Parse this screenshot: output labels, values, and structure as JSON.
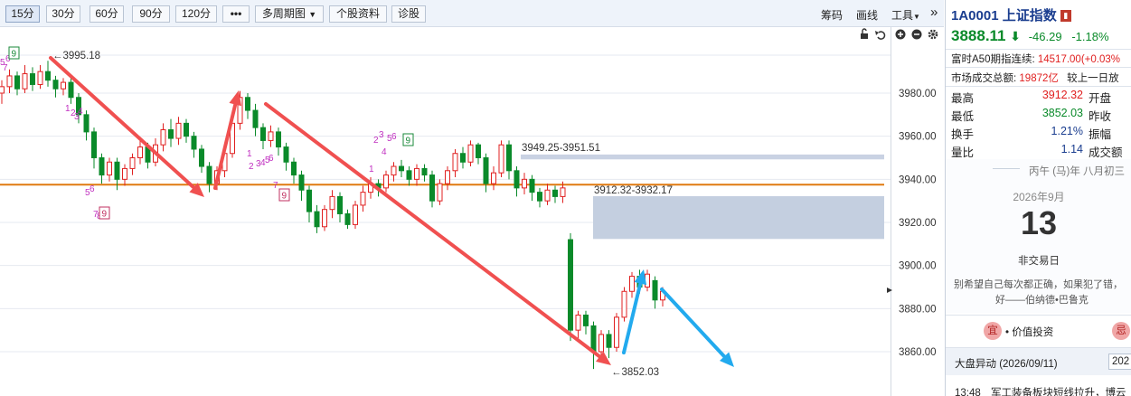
{
  "toolbar": {
    "periods": [
      "15分",
      "30分",
      "60分",
      "90分",
      "120分"
    ],
    "active_period": "15分",
    "more": "•••",
    "multi_period": "多周期图",
    "stock_info": "个股资料",
    "diagnose": "诊股",
    "chips": "筹码",
    "draw": "画线",
    "tools": "工具",
    "expand": "»"
  },
  "stock": {
    "code": "1A0001",
    "name": "上证指数",
    "badge": "■",
    "price": "3888.11",
    "change": "-46.29",
    "change_pct": "-1.18%",
    "a50_label": "富时A50期指连续:",
    "a50_value": "14517.00(+0.03%",
    "turnover_label": "市场成交总额:",
    "turnover_value": "19872亿",
    "turnover_compare": "较上一日放",
    "quote": [
      {
        "label": "最高",
        "value": "3912.32",
        "label2": "开盘",
        "value2": ""
      },
      {
        "label": "最低",
        "value": "3852.03",
        "label2": "昨收",
        "value2": ""
      },
      {
        "label": "换手",
        "value": "1.21%",
        "label2": "振幅",
        "value2": ""
      },
      {
        "label": "量比",
        "value": "1.14",
        "label2": "成交额",
        "value2": ""
      }
    ]
  },
  "calendar": {
    "lunar": "丙午 (马)年 八月初三",
    "month": "2026年9月",
    "day": "13",
    "status": "非交易日",
    "quote_line1": "别希望自己每次都正确，如果犯了错，",
    "quote_line2": "好——伯纳德•巴鲁克",
    "good_badge": "宜",
    "good_text": "• 价值投资",
    "bad_badge": "忌"
  },
  "news": {
    "title": "大盘异动 (2026/09/11)",
    "date_button": "202",
    "time": "13:48",
    "text": "军工装备板块短线拉升，博云"
  },
  "chart_data": {
    "type": "candlestick",
    "ylim": [
      3848,
      4002
    ],
    "yticks": [
      "3860.00",
      "3880.00",
      "3900.00",
      "3920.00",
      "3940.00",
      "3960.00",
      "3980.00"
    ],
    "ytick_values": [
      3860,
      3880,
      3900,
      3920,
      3940,
      3960,
      3980
    ],
    "annotations": {
      "high_label": "←3995.18",
      "low_label": "←3852.03",
      "zone1_label": "3949.25-3951.51",
      "zone2_label": "3912.32-3932.17"
    },
    "horizontal_line": 3937.5,
    "gap_zone1": [
      3949.25,
      3951.51
    ],
    "gap_zone2": [
      3912.32,
      3932.17
    ],
    "td_labels": [
      "9",
      "7",
      "9",
      "9"
    ],
    "candles": [
      [
        3980,
        3983,
        3975,
        3986
      ],
      [
        3983,
        3988,
        3980,
        3991
      ],
      [
        3988,
        3982,
        3979,
        3990
      ],
      [
        3982,
        3989,
        3980,
        3993
      ],
      [
        3989,
        3984,
        3981,
        3992
      ],
      [
        3984,
        3990,
        3982,
        3993
      ],
      [
        3990,
        3986,
        3983,
        3995
      ],
      [
        3986,
        3982,
        3978,
        3988
      ],
      [
        3982,
        3985,
        3979,
        3987
      ],
      [
        3985,
        3978,
        3975,
        3987
      ],
      [
        3978,
        3970,
        3966,
        3980
      ],
      [
        3970,
        3962,
        3958,
        3972
      ],
      [
        3962,
        3950,
        3945,
        3964
      ],
      [
        3950,
        3942,
        3938,
        3952
      ],
      [
        3942,
        3948,
        3939,
        3950
      ],
      [
        3948,
        3940,
        3935,
        3950
      ],
      [
        3940,
        3945,
        3937,
        3947
      ],
      [
        3945,
        3950,
        3942,
        3952
      ],
      [
        3950,
        3955,
        3947,
        3958
      ],
      [
        3955,
        3948,
        3945,
        3957
      ],
      [
        3948,
        3956,
        3946,
        3959
      ],
      [
        3956,
        3963,
        3953,
        3966
      ],
      [
        3963,
        3959,
        3955,
        3968
      ],
      [
        3959,
        3966,
        3956,
        3969
      ],
      [
        3966,
        3960,
        3957,
        3968
      ],
      [
        3960,
        3954,
        3950,
        3962
      ],
      [
        3954,
        3946,
        3943,
        3956
      ],
      [
        3946,
        3938,
        3934,
        3948
      ],
      [
        3938,
        3944,
        3935,
        3946
      ],
      [
        3944,
        3952,
        3941,
        3954
      ],
      [
        3952,
        3966,
        3950,
        3969
      ],
      [
        3966,
        3978,
        3963,
        3981
      ],
      [
        3978,
        3972,
        3968,
        3980
      ],
      [
        3972,
        3964,
        3960,
        3975
      ],
      [
        3964,
        3958,
        3954,
        3966
      ],
      [
        3958,
        3962,
        3955,
        3965
      ],
      [
        3962,
        3955,
        3951,
        3964
      ],
      [
        3955,
        3948,
        3944,
        3957
      ],
      [
        3948,
        3942,
        3938,
        3950
      ],
      [
        3942,
        3935,
        3930,
        3944
      ],
      [
        3935,
        3925,
        3920,
        3937
      ],
      [
        3925,
        3918,
        3915,
        3928
      ],
      [
        3918,
        3926,
        3916,
        3928
      ],
      [
        3926,
        3932,
        3922,
        3935
      ],
      [
        3932,
        3924,
        3920,
        3934
      ],
      [
        3924,
        3919,
        3917,
        3926
      ],
      [
        3919,
        3928,
        3917,
        3930
      ],
      [
        3928,
        3934,
        3925,
        3937
      ],
      [
        3934,
        3938,
        3931,
        3941
      ],
      [
        3938,
        3936,
        3932,
        3940
      ],
      [
        3936,
        3942,
        3934,
        3944
      ],
      [
        3942,
        3946,
        3939,
        3948
      ],
      [
        3946,
        3944,
        3941,
        3949
      ],
      [
        3944,
        3940,
        3937,
        3946
      ],
      [
        3940,
        3945,
        3937,
        3947
      ],
      [
        3945,
        3942,
        3939,
        3947
      ],
      [
        3942,
        3930,
        3927,
        3944
      ],
      [
        3930,
        3938,
        3928,
        3940
      ],
      [
        3938,
        3944,
        3935,
        3946
      ],
      [
        3944,
        3952,
        3941,
        3954
      ],
      [
        3952,
        3948,
        3945,
        3955
      ],
      [
        3948,
        3956,
        3946,
        3958
      ],
      [
        3956,
        3950,
        3947,
        3957
      ],
      [
        3950,
        3938,
        3934,
        3952
      ],
      [
        3938,
        3943,
        3935,
        3946
      ],
      [
        3943,
        3956,
        3941,
        3958
      ],
      [
        3956,
        3944,
        3940,
        3958
      ],
      [
        3944,
        3936,
        3932,
        3946
      ],
      [
        3936,
        3940,
        3933,
        3943
      ],
      [
        3940,
        3934,
        3930,
        3942
      ],
      [
        3934,
        3930,
        3927,
        3936
      ],
      [
        3930,
        3935,
        3928,
        3938
      ],
      [
        3935,
        3932,
        3929,
        3937
      ],
      [
        3932,
        3936,
        3929,
        3939
      ],
      [
        3912,
        3870,
        3865,
        3915
      ],
      [
        3870,
        3877,
        3866,
        3879
      ],
      [
        3877,
        3872,
        3868,
        3879
      ],
      [
        3872,
        3860,
        3852,
        3874
      ],
      [
        3860,
        3868,
        3855,
        3870
      ],
      [
        3868,
        3862,
        3857,
        3870
      ],
      [
        3862,
        3876,
        3860,
        3878
      ],
      [
        3876,
        3888,
        3874,
        3890
      ],
      [
        3888,
        3895,
        3885,
        3897
      ],
      [
        3895,
        3890,
        3887,
        3898
      ],
      [
        3890,
        3896,
        3888,
        3898
      ],
      [
        3893,
        3884,
        3880,
        3895
      ],
      [
        3884,
        3888,
        3881,
        3890
      ]
    ]
  }
}
